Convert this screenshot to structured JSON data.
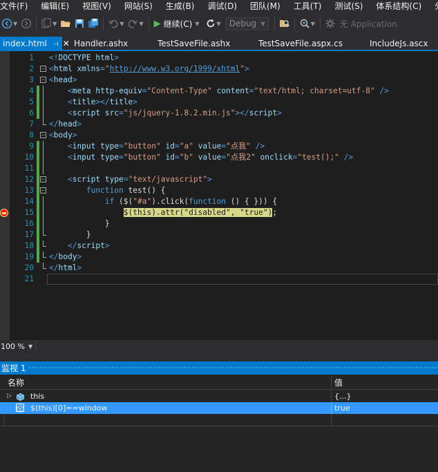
{
  "menu": [
    "文件(F)",
    "编辑(E)",
    "视图(V)",
    "网站(S)",
    "生成(B)",
    "调试(D)",
    "团队(M)",
    "工具(T)",
    "测试(S)",
    "体系结构(C)",
    "分"
  ],
  "toolbar": {
    "continue_label": "继续(C)",
    "config_value": "Debug",
    "app_label": "无 Application"
  },
  "tabs": [
    {
      "label": "index.html",
      "active": true
    },
    {
      "label": "Handler.ashx",
      "active": false
    },
    {
      "label": "TestSaveFile.ashx",
      "active": false
    },
    {
      "label": "TestSaveFile.aspx.cs",
      "active": false
    },
    {
      "label": "IncludeJs.ascx",
      "active": false
    }
  ],
  "tab_pin_icon": "pin-icon",
  "tab_close_icon": "close-icon",
  "editor": {
    "lines": [
      {
        "n": "1",
        "tokens": [
          [
            "t-blue",
            "<!"
          ],
          [
            "t-red",
            "DOCTYPE"
          ],
          [
            "t-text",
            " "
          ],
          [
            "t-attr",
            "html"
          ],
          [
            "t-blue",
            ">"
          ]
        ]
      },
      {
        "n": "2",
        "tokens": [
          [
            "t-blue",
            "<"
          ],
          [
            "t-red",
            "html"
          ],
          [
            "t-text",
            " "
          ],
          [
            "t-attr",
            "xmlns"
          ],
          [
            "t-blue",
            "="
          ],
          [
            "t-str",
            "\""
          ],
          [
            "t-link",
            "http://www.w3.org/1999/xhtml"
          ],
          [
            "t-str",
            "\""
          ],
          [
            "t-blue",
            ">"
          ]
        ]
      },
      {
        "n": "3",
        "tokens": [
          [
            "t-blue",
            "<"
          ],
          [
            "t-red",
            "head"
          ],
          [
            "t-blue",
            ">"
          ]
        ]
      },
      {
        "n": "4",
        "tokens": [
          [
            "t-text",
            "    "
          ],
          [
            "t-blue",
            "<"
          ],
          [
            "t-red",
            "meta"
          ],
          [
            "t-text",
            " "
          ],
          [
            "t-attr",
            "http-equiv"
          ],
          [
            "t-blue",
            "="
          ],
          [
            "t-str",
            "\"Content-Type\""
          ],
          [
            "t-text",
            " "
          ],
          [
            "t-attr",
            "content"
          ],
          [
            "t-blue",
            "="
          ],
          [
            "t-str",
            "\"text/html; charset=utf-8\""
          ],
          [
            "t-text",
            " "
          ],
          [
            "t-blue",
            "/>"
          ]
        ]
      },
      {
        "n": "5",
        "tokens": [
          [
            "t-text",
            "    "
          ],
          [
            "t-blue",
            "<"
          ],
          [
            "t-red",
            "title"
          ],
          [
            "t-blue",
            "></"
          ],
          [
            "t-red",
            "title"
          ],
          [
            "t-blue",
            ">"
          ]
        ]
      },
      {
        "n": "6",
        "tokens": [
          [
            "t-text",
            "    "
          ],
          [
            "t-blue",
            "<"
          ],
          [
            "t-red",
            "script"
          ],
          [
            "t-text",
            " "
          ],
          [
            "t-attr",
            "src"
          ],
          [
            "t-blue",
            "="
          ],
          [
            "t-str",
            "\"js/jquery-1.8.2.min.js\""
          ],
          [
            "t-blue",
            "></"
          ],
          [
            "t-red",
            "script"
          ],
          [
            "t-blue",
            ">"
          ]
        ]
      },
      {
        "n": "7",
        "tokens": [
          [
            "t-blue",
            "</"
          ],
          [
            "t-red",
            "head"
          ],
          [
            "t-blue",
            ">"
          ]
        ]
      },
      {
        "n": "8",
        "tokens": [
          [
            "t-blue",
            "<"
          ],
          [
            "t-red",
            "body"
          ],
          [
            "t-blue",
            ">"
          ]
        ]
      },
      {
        "n": "9",
        "tokens": [
          [
            "t-text",
            "    "
          ],
          [
            "t-blue",
            "<"
          ],
          [
            "t-red",
            "input"
          ],
          [
            "t-text",
            " "
          ],
          [
            "t-attr",
            "type"
          ],
          [
            "t-blue",
            "="
          ],
          [
            "t-str",
            "\"button\""
          ],
          [
            "t-text",
            " "
          ],
          [
            "t-attr",
            "id"
          ],
          [
            "t-blue",
            "="
          ],
          [
            "t-str",
            "\"a\""
          ],
          [
            "t-text",
            " "
          ],
          [
            "t-attr",
            "value"
          ],
          [
            "t-blue",
            "="
          ],
          [
            "t-str",
            "\"点我\""
          ],
          [
            "t-text",
            " "
          ],
          [
            "t-blue",
            "/>"
          ]
        ]
      },
      {
        "n": "10",
        "tokens": [
          [
            "t-text",
            "    "
          ],
          [
            "t-blue",
            "<"
          ],
          [
            "t-red",
            "input"
          ],
          [
            "t-text",
            " "
          ],
          [
            "t-attr",
            "type"
          ],
          [
            "t-blue",
            "="
          ],
          [
            "t-str",
            "\"button\""
          ],
          [
            "t-text",
            " "
          ],
          [
            "t-attr",
            "id"
          ],
          [
            "t-blue",
            "="
          ],
          [
            "t-str",
            "\"b\""
          ],
          [
            "t-text",
            " "
          ],
          [
            "t-attr",
            "value"
          ],
          [
            "t-blue",
            "="
          ],
          [
            "t-str",
            "\"点我2\""
          ],
          [
            "t-text",
            " "
          ],
          [
            "t-attr",
            "onclick"
          ],
          [
            "t-blue",
            "="
          ],
          [
            "t-str",
            "\"test();\""
          ],
          [
            "t-text",
            " "
          ],
          [
            "t-blue",
            "/>"
          ]
        ]
      },
      {
        "n": "11",
        "tokens": []
      },
      {
        "n": "12",
        "tokens": [
          [
            "t-text",
            "    "
          ],
          [
            "t-blue",
            "<"
          ],
          [
            "t-red",
            "script"
          ],
          [
            "t-text",
            " "
          ],
          [
            "t-attr",
            "type"
          ],
          [
            "t-blue",
            "="
          ],
          [
            "t-str",
            "\"text/javascript\""
          ],
          [
            "t-blue",
            ">"
          ]
        ]
      },
      {
        "n": "13",
        "tokens": [
          [
            "t-text",
            "        "
          ],
          [
            "t-kw",
            "function"
          ],
          [
            "t-text",
            " test() {"
          ]
        ]
      },
      {
        "n": "14",
        "tokens": [
          [
            "t-text",
            "            "
          ],
          [
            "t-kw",
            "if"
          ],
          [
            "t-text",
            " ($("
          ],
          [
            "t-str",
            "\"#a\""
          ],
          [
            "t-text",
            ").click("
          ],
          [
            "t-kw",
            "function"
          ],
          [
            "t-text",
            " () { })) {"
          ]
        ]
      },
      {
        "n": "15",
        "tokens": [
          [
            "t-text",
            "                "
          ],
          [
            "hl",
            "$(this).attr(\"disabled\", \"true\")"
          ],
          [
            "t-text",
            ";"
          ]
        ]
      },
      {
        "n": "16",
        "tokens": [
          [
            "t-text",
            "            }"
          ]
        ]
      },
      {
        "n": "17",
        "tokens": [
          [
            "t-text",
            "        }"
          ]
        ]
      },
      {
        "n": "18",
        "tokens": [
          [
            "t-text",
            "    "
          ],
          [
            "t-blue",
            "</"
          ],
          [
            "t-red",
            "script"
          ],
          [
            "t-blue",
            ">"
          ]
        ]
      },
      {
        "n": "19",
        "tokens": [
          [
            "t-blue",
            "</"
          ],
          [
            "t-red",
            "body"
          ],
          [
            "t-blue",
            ">"
          ]
        ]
      },
      {
        "n": "20",
        "tokens": [
          [
            "t-blue",
            "</"
          ],
          [
            "t-red",
            "html"
          ],
          [
            "t-blue",
            ">"
          ]
        ]
      },
      {
        "n": "21",
        "tokens": []
      }
    ],
    "current_line": "21",
    "breakpoint_line": "15",
    "breakpoint_icon": "breakpoint-current-statement-icon"
  },
  "zoom": {
    "label": "100 %"
  },
  "watch": {
    "title": "监视 1",
    "col_name": "名称",
    "col_value": "值",
    "rows": [
      {
        "name": "this",
        "value": "{...}",
        "expandable": true,
        "selected": false,
        "icon": "object-icon"
      },
      {
        "name": "$(this)[0]==window",
        "value": "true",
        "expandable": false,
        "selected": true,
        "icon": "object-icon"
      }
    ]
  },
  "colors": {
    "accent": "#007acc",
    "selection": "#3399ff",
    "change_saved": "#57a64a",
    "highlight": "#d7d78a"
  }
}
